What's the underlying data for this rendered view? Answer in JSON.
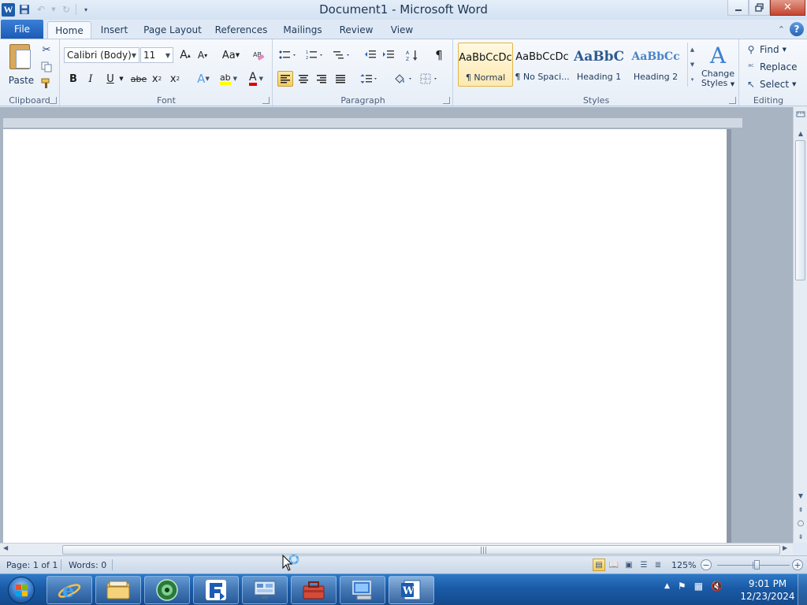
{
  "window": {
    "title": "Document1  -  Microsoft Word",
    "app_icon_letter": "W",
    "controls": [
      "minimize",
      "maximize",
      "close"
    ]
  },
  "quick_access": [
    "save-icon",
    "undo-icon",
    "redo-icon",
    "customize-icon"
  ],
  "tabs": {
    "file": "File",
    "items": [
      {
        "label": "Home",
        "active": true
      },
      {
        "label": "Insert"
      },
      {
        "label": "Page Layout"
      },
      {
        "label": "References"
      },
      {
        "label": "Mailings"
      },
      {
        "label": "Review"
      },
      {
        "label": "View"
      }
    ],
    "help": "?"
  },
  "ribbon": {
    "clipboard": {
      "label": "Clipboard",
      "paste": "Paste"
    },
    "font": {
      "label": "Font",
      "font_name": "Calibri (Body)",
      "font_size": "11",
      "grow_glyph": "A",
      "shrink_glyph": "A",
      "case_glyph": "Aa",
      "bold": "B",
      "italic": "I",
      "underline": "U",
      "strike": "abe",
      "subscript": "x",
      "superscript": "x",
      "effects_glyph": "A",
      "highlight_glyph": "ab",
      "color_glyph": "A",
      "highlight_color": "#ffff00",
      "font_color": "#e00000"
    },
    "paragraph": {
      "label": "Paragraph",
      "pilcrow": "¶"
    },
    "styles": {
      "label": "Styles",
      "items": [
        {
          "sample": "AaBbCcDc",
          "name": "¶ Normal",
          "selected": true
        },
        {
          "sample": "AaBbCcDc",
          "name": "¶ No Spaci..."
        },
        {
          "sample": "AaBbC",
          "name": "Heading 1"
        },
        {
          "sample": "AaBbCc",
          "name": "Heading 2"
        }
      ],
      "change_styles": [
        "Change",
        "Styles"
      ]
    },
    "editing": {
      "label": "Editing",
      "find": "Find",
      "replace": "Replace",
      "select": "Select"
    }
  },
  "status": {
    "page": "Page: 1 of 1",
    "words": "Words: 0",
    "zoom": "125%",
    "zoom_level_fraction": 0.55
  },
  "taskbar": {
    "apps": [
      "internet-explorer",
      "file-explorer",
      "media-center",
      "app-f",
      "remote-desktop",
      "toolbox",
      "computer",
      "microsoft-word"
    ],
    "clock_time": "9:01 PM",
    "clock_date": "12/23/2024"
  },
  "colors": {
    "accent": "#1c5bb6",
    "ribbon_bg": "#eef3fa",
    "taskbar": "#1a5aa6"
  }
}
